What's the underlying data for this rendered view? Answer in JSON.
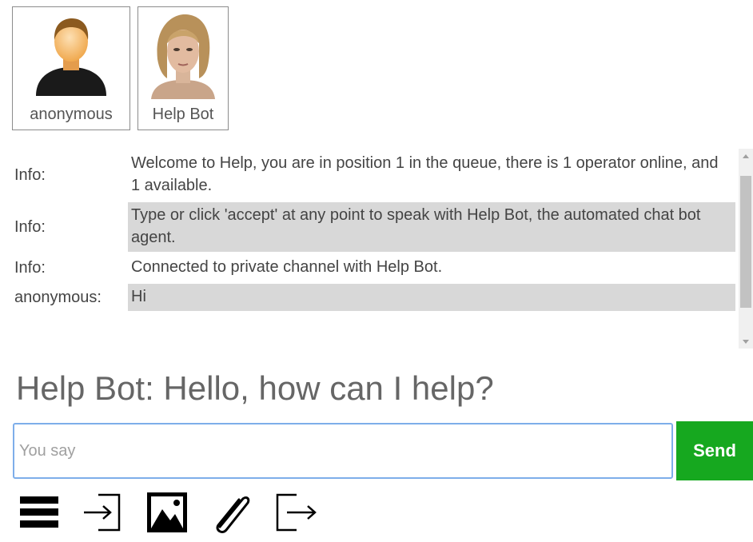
{
  "participants": [
    {
      "name": "anonymous",
      "avatar": "user-silhouette-icon"
    },
    {
      "name": "Help Bot",
      "avatar": "bot-avatar-portrait"
    }
  ],
  "log": [
    {
      "who": "Info:",
      "text": "Welcome to Help, you are in position 1 in the queue, there is 1 operator online, and 1 available.",
      "shaded": false
    },
    {
      "who": "Info:",
      "text": "Type or click 'accept' at any point to speak with Help Bot, the automated chat bot agent.",
      "shaded": true
    },
    {
      "who": "Info:",
      "text": "Connected to private channel with Help Bot.",
      "shaded": false
    },
    {
      "who": "anonymous:",
      "text": "Hi",
      "shaded": true
    }
  ],
  "response": "Help Bot: Hello, how can I help?",
  "input": {
    "placeholder": "You say",
    "value": ""
  },
  "send_label": "Send",
  "toolbar": [
    "menu-icon",
    "sign-in-icon",
    "image-icon",
    "attachment-icon",
    "exit-icon"
  ],
  "colors": {
    "send": "#16a81f",
    "input_border": "#7eaeea",
    "shaded_row": "#d8d8d8"
  }
}
